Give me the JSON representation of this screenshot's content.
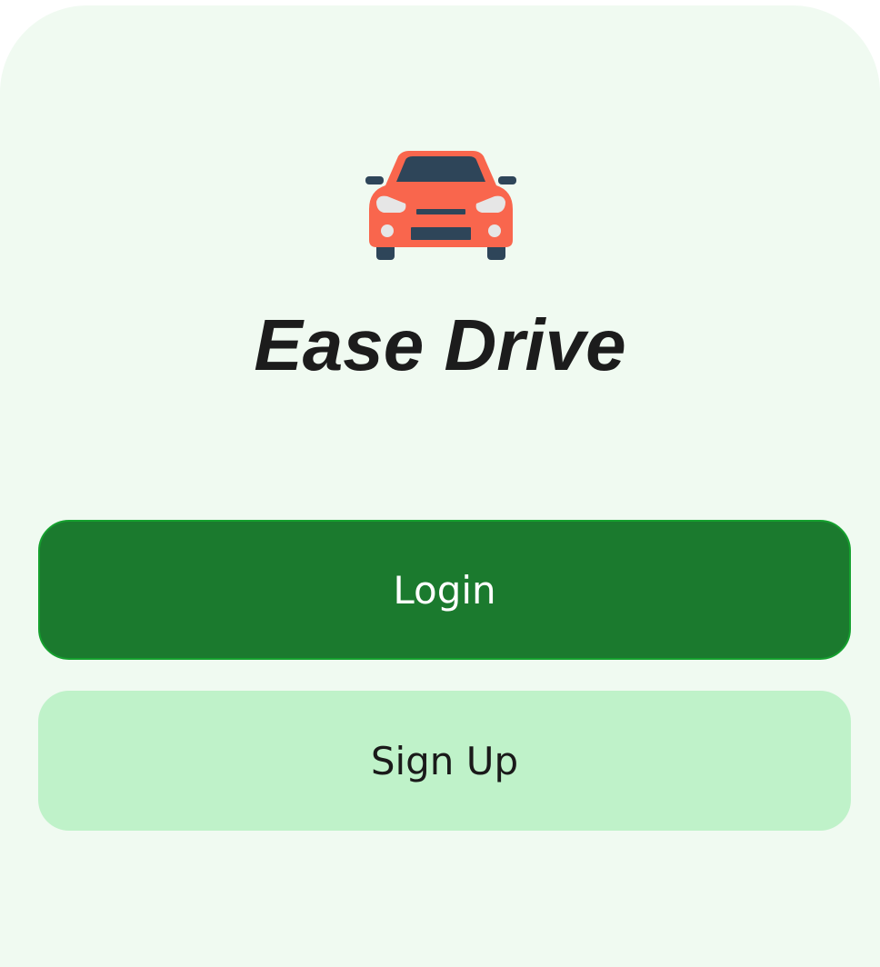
{
  "app": {
    "title": "Ease Drive",
    "logo_icon": "car-icon"
  },
  "actions": {
    "login_label": "Login",
    "signup_label": "Sign Up"
  },
  "colors": {
    "background": "#f0faf1",
    "primary": "#1b7a2e",
    "secondary": "#bff2c9",
    "car_body": "#f9664d",
    "car_dark": "#2e4559"
  }
}
